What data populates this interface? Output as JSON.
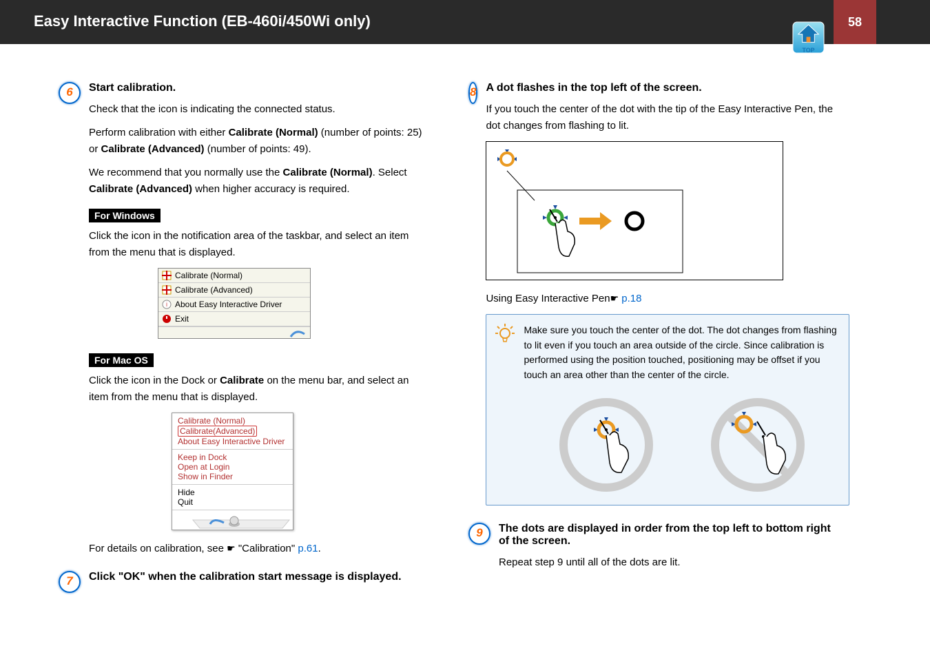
{
  "header": {
    "title": "Easy Interactive Function (EB-460i/450Wi only)",
    "page_num": "58",
    "top_label": "TOP"
  },
  "left": {
    "step6": {
      "num": "6",
      "title": "Start calibration.",
      "p1": "Check that the icon is indicating the connected status.",
      "p2a": "Perform calibration with either ",
      "p2b": "Calibrate (Normal)",
      "p2c": " (number of points: 25) or ",
      "p2d": "Calibrate (Advanced)",
      "p2e": " (number of points: 49).",
      "p3a": "We recommend that you normally use the ",
      "p3b": "Calibrate (Normal)",
      "p3c": ". Select ",
      "p3d": "Calibrate (Advanced)",
      "p3e": " when higher accuracy is required.",
      "os_win": "For Windows",
      "win_text": "Click the icon in the notification area of the taskbar, and select an item from the menu that is displayed.",
      "win_menu": {
        "m1": "Calibrate (Normal)",
        "m2": "Calibrate (Advanced)",
        "m3": "About Easy Interactive Driver",
        "m4": "Exit"
      },
      "os_mac": "For Mac OS",
      "mac_text_a": "Click the icon in the Dock or ",
      "mac_text_b": "Calibrate",
      "mac_text_c": " on the menu bar, and select an item from the menu that is displayed.",
      "mac_menu": {
        "m1": "Calibrate (Normal)",
        "m2": "Calibrate(Advanced)",
        "m3": "About Easy Interactive Driver",
        "m4": "Keep in Dock",
        "m5": "Open at Login",
        "m6": "Show in Finder",
        "m7": "Hide",
        "m8": "Quit"
      },
      "details_a": "For details on calibration, see ",
      "details_b": "\"Calibration\" ",
      "details_link": "p.61",
      "details_c": "."
    },
    "step7": {
      "num": "7",
      "title": "Click \"OK\" when the calibration start message is displayed."
    }
  },
  "right": {
    "step8": {
      "num": "8",
      "title": "A dot flashes in the top left of the screen.",
      "p1": "If you touch the center of the dot with the tip of the Easy Interactive Pen, the dot changes from flashing to lit.",
      "ref_a": "Using Easy Interactive Pen",
      "ref_link": "p.18",
      "tip": "Make sure you touch the center of the dot. The dot changes from flashing to lit even if you touch an area outside of the circle. Since calibration is performed using the position touched, positioning may be offset if you touch an area other than the center of the circle."
    },
    "step9": {
      "num": "9",
      "title": "The dots are displayed in order from the top left to bottom right of the screen.",
      "p1": "Repeat step 9 until all of the dots are lit."
    }
  }
}
